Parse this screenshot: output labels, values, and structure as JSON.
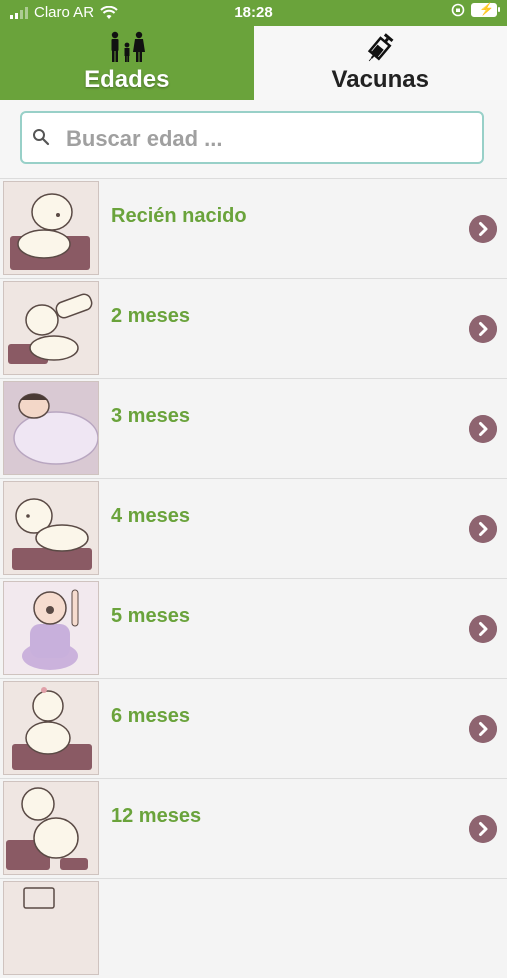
{
  "status": {
    "carrier": "Claro AR",
    "time": "18:28"
  },
  "tabs": [
    {
      "label": "Edades",
      "icon": "family-icon",
      "active": true
    },
    {
      "label": "Vacunas",
      "icon": "syringe-icon",
      "active": false
    }
  ],
  "search": {
    "placeholder": "Buscar edad ...",
    "value": ""
  },
  "ages": [
    {
      "label": "Recién nacido"
    },
    {
      "label": "2 meses"
    },
    {
      "label": "3 meses"
    },
    {
      "label": "4 meses"
    },
    {
      "label": "5 meses"
    },
    {
      "label": "6 meses"
    },
    {
      "label": "12 meses"
    }
  ],
  "colors": {
    "brand_green": "#6aa33b",
    "chevron": "#8e6470",
    "search_border": "#98d0c8"
  }
}
